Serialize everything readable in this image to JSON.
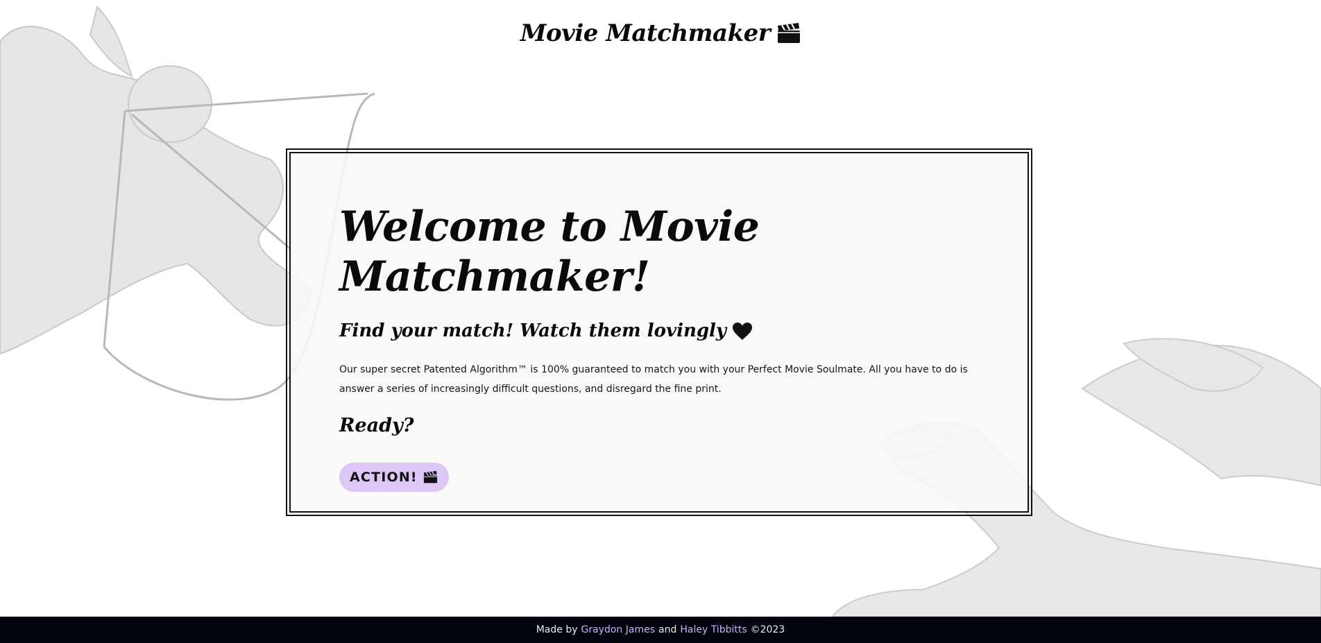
{
  "header": {
    "title": "Movie Matchmaker"
  },
  "welcome": {
    "heading": "Welcome to Movie Matchmaker!",
    "tagline": "Find your match! Watch them lovingly",
    "description": "Our super secret Patented Algorithm™ is 100% guaranteed to match you with your Perfect Movie Soulmate. All you have to do is answer a series of increasingly difficult questions, and disregard the fine print.",
    "ready_label": "Ready?",
    "action_label": "ACTION!"
  },
  "footer": {
    "made_by": "Made by",
    "author_one": "Graydon James",
    "conjunction": "and",
    "author_two": "Haley Tibbitts",
    "copyright": "©2023"
  },
  "icons": {
    "title_icon": "clapperboard-icon",
    "tagline_icon": "heart-icon",
    "button_icon": "clapperboard-icon",
    "background": "cupid-engraving"
  },
  "colors": {
    "background": "#ffffff",
    "card_background": "#f8f8f6",
    "button_background": "#dcc7f7",
    "footer_background": "#03050e",
    "footer_link": "#c5b3f5",
    "text": "#0a0a0a"
  }
}
